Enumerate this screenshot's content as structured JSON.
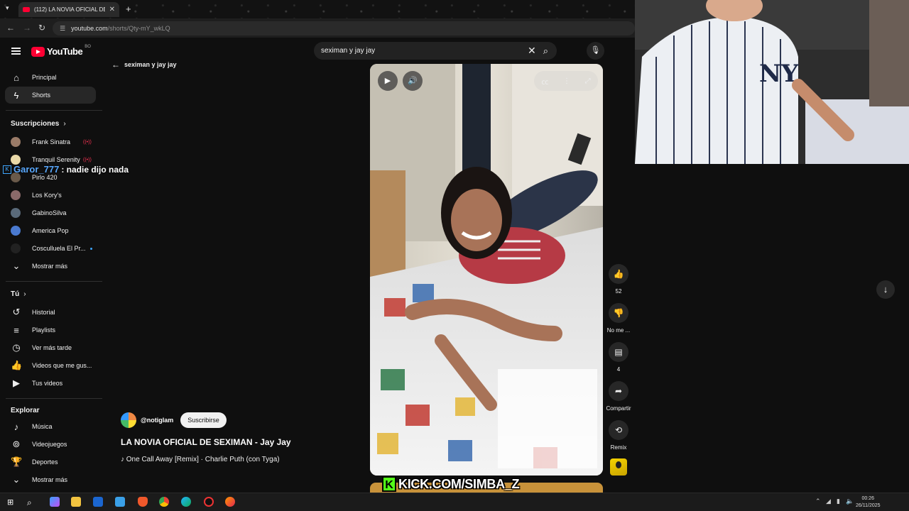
{
  "browser": {
    "tab_title": "(112) LA NOVIA OFICIAL DE SE...",
    "tab_close": "✕",
    "new_tab": "+",
    "url_domain": "youtube.com",
    "url_path": "/shorts/Qty-mY_wkLQ"
  },
  "youtube": {
    "logo_text": "YouTube",
    "country_code": "BO"
  },
  "search": {
    "query": "seximan y jay jay"
  },
  "back_label": "seximan y jay jay",
  "sidebar": {
    "main": [
      {
        "label": "Principal",
        "icon": "home-icon"
      },
      {
        "label": "Shorts",
        "icon": "shorts-icon",
        "active": true
      }
    ],
    "subs_header": "Suscripciones",
    "subscriptions": [
      {
        "label": "Frank Sinatra",
        "live": true,
        "color": "#9a7b68"
      },
      {
        "label": "Tranquil Serenity",
        "live": true,
        "color": "#e9d9a8"
      },
      {
        "label": "Pirlo 420",
        "live": false,
        "color": "#6a5a4a"
      },
      {
        "label": "Los Kory's",
        "live": false,
        "color": "#8a6a6a"
      },
      {
        "label": "GabinoSilva",
        "live": false,
        "color": "#5a6a7a"
      },
      {
        "label": "America Pop",
        "live": false,
        "color": "#4a7ad0"
      },
      {
        "label": "Cosculluela El Pr...",
        "live": false,
        "dot": true,
        "color": "#222222"
      }
    ],
    "subs_more": "Mostrar más",
    "you_header": "Tú",
    "you_items": [
      {
        "label": "Historial",
        "icon": "history-icon"
      },
      {
        "label": "Playlists",
        "icon": "playlists-icon"
      },
      {
        "label": "Ver más tarde",
        "icon": "watch-later-icon"
      },
      {
        "label": "Videos que me gus...",
        "icon": "liked-videos-icon"
      },
      {
        "label": "Tus videos",
        "icon": "your-videos-icon"
      }
    ],
    "explore_header": "Explorar",
    "explore_items": [
      {
        "label": "Música",
        "icon": "music-icon"
      },
      {
        "label": "Videojuegos",
        "icon": "gaming-icon"
      },
      {
        "label": "Deportes",
        "icon": "sports-icon"
      },
      {
        "label": "Mostrar más",
        "icon": "chevron-down-icon"
      }
    ]
  },
  "chat": {
    "user": "Garor_777",
    "message": ": nadie dijo nada"
  },
  "short": {
    "channel": "@notiglam",
    "subscribe": "Suscribirse",
    "title": "LA NOVIA OFICIAL DE SEXIMAN - Jay Jay",
    "music": "♪ One Call Away [Remix] · Charlie Puth (con Tyga)"
  },
  "actions": {
    "likes": "52",
    "dislike": "No me ...",
    "comments": "4",
    "share": "Compartir",
    "remix": "Remix"
  },
  "overlay": {
    "kick_letter": "K",
    "kick_url": "KICK.COM/SIMBA_Z"
  },
  "clock": {
    "time": "00:26",
    "date": "26/11/2025"
  }
}
